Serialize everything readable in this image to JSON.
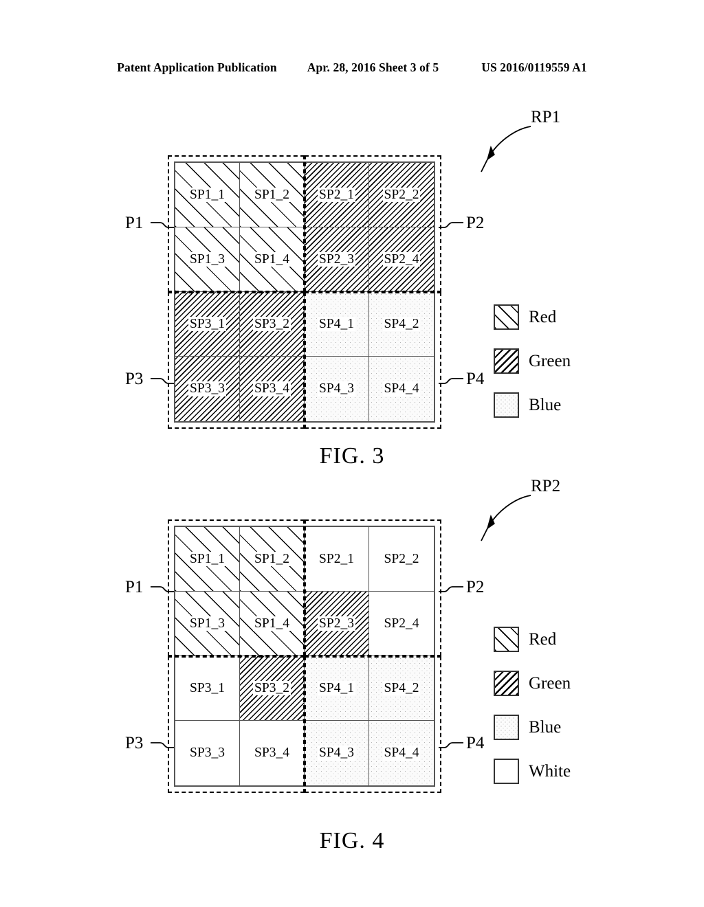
{
  "header": {
    "publication": "Patent Application Publication",
    "date_sheet": "Apr. 28, 2016  Sheet 3 of 5",
    "patent_number": "US 2016/0119559 A1"
  },
  "figures": [
    {
      "id": "fig3",
      "caption": "FIG. 3",
      "callout": "RP1",
      "quadrant_labels": {
        "top_left": "P1",
        "top_right": "P2",
        "bottom_left": "P3",
        "bottom_right": "P4"
      },
      "cells": [
        {
          "label": "SP1_1",
          "fill": "red"
        },
        {
          "label": "SP1_2",
          "fill": "red"
        },
        {
          "label": "SP2_1",
          "fill": "green"
        },
        {
          "label": "SP2_2",
          "fill": "green"
        },
        {
          "label": "SP1_3",
          "fill": "red"
        },
        {
          "label": "SP1_4",
          "fill": "red"
        },
        {
          "label": "SP2_3",
          "fill": "green"
        },
        {
          "label": "SP2_4",
          "fill": "green"
        },
        {
          "label": "SP3_1",
          "fill": "green"
        },
        {
          "label": "SP3_2",
          "fill": "green"
        },
        {
          "label": "SP4_1",
          "fill": "blue"
        },
        {
          "label": "SP4_2",
          "fill": "blue"
        },
        {
          "label": "SP3_3",
          "fill": "green"
        },
        {
          "label": "SP3_4",
          "fill": "green"
        },
        {
          "label": "SP4_3",
          "fill": "blue"
        },
        {
          "label": "SP4_4",
          "fill": "blue"
        }
      ],
      "legend": [
        {
          "swatch": "red",
          "text": "Red"
        },
        {
          "swatch": "green",
          "text": "Green"
        },
        {
          "swatch": "blue",
          "text": "Blue"
        }
      ]
    },
    {
      "id": "fig4",
      "caption": "FIG. 4",
      "callout": "RP2",
      "quadrant_labels": {
        "top_left": "P1",
        "top_right": "P2",
        "bottom_left": "P3",
        "bottom_right": "P4"
      },
      "cells": [
        {
          "label": "SP1_1",
          "fill": "red"
        },
        {
          "label": "SP1_2",
          "fill": "red"
        },
        {
          "label": "SP2_1",
          "fill": "white"
        },
        {
          "label": "SP2_2",
          "fill": "white"
        },
        {
          "label": "SP1_3",
          "fill": "red"
        },
        {
          "label": "SP1_4",
          "fill": "red"
        },
        {
          "label": "SP2_3",
          "fill": "green"
        },
        {
          "label": "SP2_4",
          "fill": "white"
        },
        {
          "label": "SP3_1",
          "fill": "white"
        },
        {
          "label": "SP3_2",
          "fill": "green"
        },
        {
          "label": "SP4_1",
          "fill": "blue"
        },
        {
          "label": "SP4_2",
          "fill": "blue"
        },
        {
          "label": "SP3_3",
          "fill": "white"
        },
        {
          "label": "SP3_4",
          "fill": "white"
        },
        {
          "label": "SP4_3",
          "fill": "blue"
        },
        {
          "label": "SP4_4",
          "fill": "blue"
        }
      ],
      "legend": [
        {
          "swatch": "red",
          "text": "Red"
        },
        {
          "swatch": "green",
          "text": "Green"
        },
        {
          "swatch": "blue",
          "text": "Blue"
        },
        {
          "swatch": "white",
          "text": "White"
        }
      ]
    }
  ]
}
